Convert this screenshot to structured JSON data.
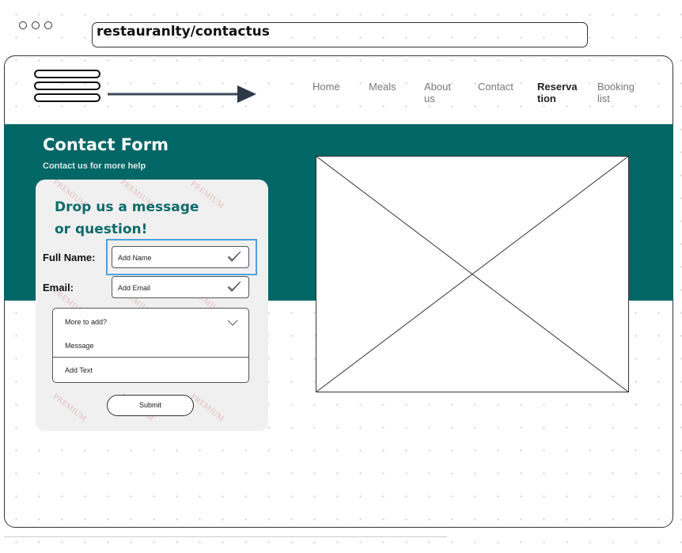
{
  "browser": {
    "url": "restauranlty/contactus"
  },
  "nav": {
    "items": [
      {
        "label": "Home"
      },
      {
        "label": "Meals"
      },
      {
        "label": "About\nus"
      },
      {
        "label": "Contact"
      },
      {
        "label": "Reserva\ntion"
      },
      {
        "label": "Booking\nlist"
      }
    ],
    "active": "Reserva tion"
  },
  "hero": {
    "title": "Contact Form",
    "subtitle": "Contact us for more help"
  },
  "form": {
    "heading": "Drop us a message or question!",
    "heading_line1": "Drop us a message",
    "heading_line2": "or question!",
    "name_label": "Full Name:",
    "name_placeholder": "Add Name",
    "email_label": "Email:",
    "email_placeholder": "Add Email",
    "select_label": "More to add?",
    "select_option": "Message",
    "text_placeholder": "Add Text",
    "submit_label": "Submit",
    "watermark": "PREMIUM"
  },
  "colors": {
    "teal": "#006666",
    "heading_teal": "#0e6b6b",
    "focus_blue": "#4aa3df",
    "watermark": "#d67878"
  },
  "icons": [
    "menu-icon",
    "arrow-right-icon",
    "check-icon",
    "chevron-down-icon",
    "image-placeholder-icon"
  ]
}
